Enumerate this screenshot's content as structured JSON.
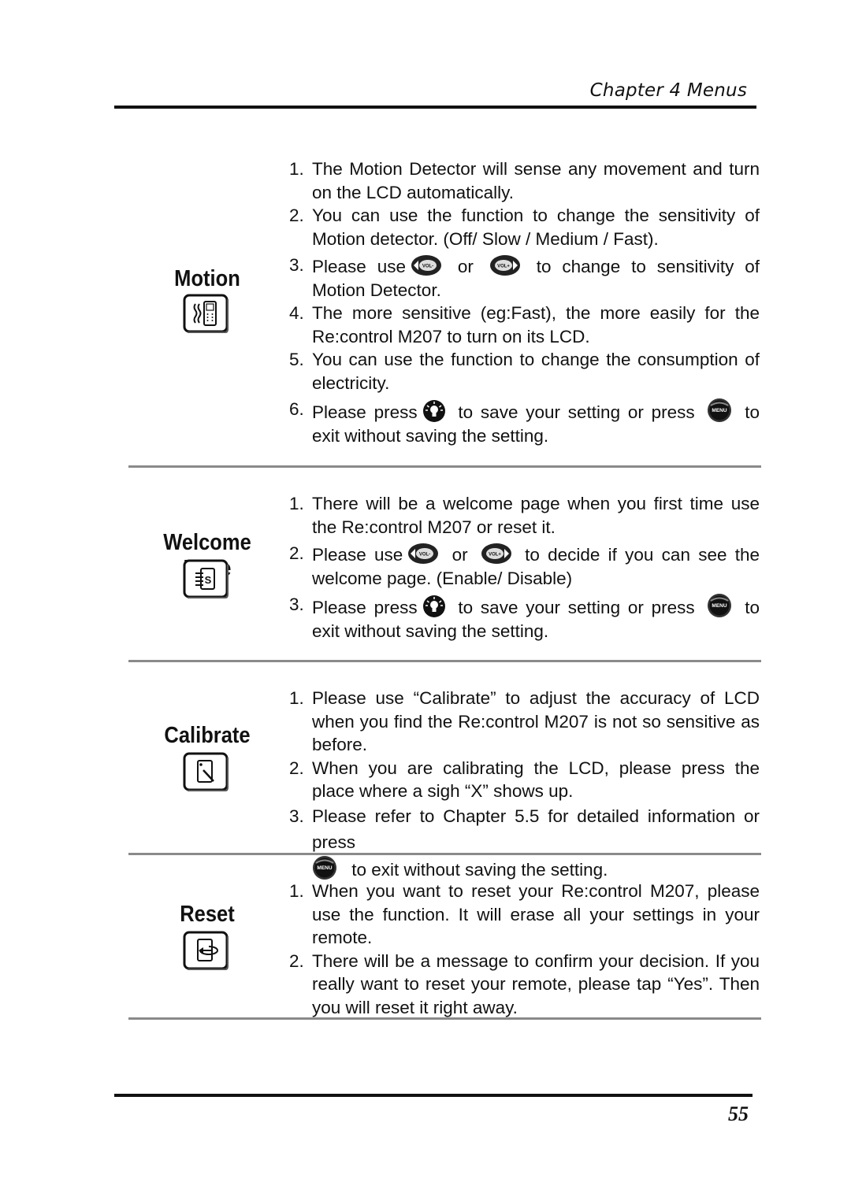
{
  "header": {
    "chapter_title": "Chapter 4 Menus"
  },
  "icons": {
    "vol_minus": "vol-minus-button-icon",
    "vol_plus": "vol-plus-button-icon",
    "save": "light-bulb-save-button-icon",
    "menu": "menu-button-icon"
  },
  "sections": [
    {
      "title": "Motion",
      "icon": "motion-detector-icon",
      "items": [
        {
          "num": "1.",
          "text": "The Motion Detector will sense any movement and turn on the LCD automatically."
        },
        {
          "num": "2.",
          "text": "You can use the function to change the sensitivity of Motion detector. (Off/ Slow / Medium / Fast)."
        },
        {
          "num": "3.",
          "pre": "Please use",
          "mid": "or",
          "post": "to change to sensitivity of Motion Detector."
        },
        {
          "num": "4.",
          "text": "The more sensitive (eg:Fast), the more easily for the Re:control M207 to turn on its LCD."
        },
        {
          "num": "5.",
          "text": "You can use the function to change the consumption of electricity."
        },
        {
          "num": "6.",
          "pre": "Please press",
          "mid": "to save your setting or press",
          "post": "to exit without saving the setting."
        }
      ]
    },
    {
      "title": "Welcome Page",
      "icon": "welcome-page-icon",
      "items": [
        {
          "num": "1.",
          "text": "There will be a welcome page when you first time use the Re:control M207 or reset it."
        },
        {
          "num": "2.",
          "pre": "Please use",
          "mid": "or",
          "post": "to decide if you can see the welcome page. (Enable/ Disable)"
        },
        {
          "num": "3.",
          "pre": "Please press",
          "mid": "to save your setting or press",
          "post": "to exit without saving the setting."
        }
      ]
    },
    {
      "title": "Calibrate",
      "icon": "calibrate-icon",
      "items": [
        {
          "num": "1.",
          "text": "Please use “Calibrate” to adjust the accuracy of LCD when you find the Re:control M207 is not so sensitive as before."
        },
        {
          "num": "2.",
          "text": "When you are calibrating the LCD, please press the place where a sigh “X” shows up."
        },
        {
          "num": "3.",
          "pre": "Please refer to Chapter 5.5 for detailed information or press",
          "post": "to exit without saving the setting."
        }
      ]
    },
    {
      "title": "Reset",
      "icon": "reset-icon",
      "items": [
        {
          "num": "1.",
          "text": "When you want to reset your Re:control M207, please use the function. It will erase all your settings in your remote."
        },
        {
          "num": "2.",
          "text": "There will be a message to confirm your decision. If you really want to reset your remote, please tap “Yes”. Then you will reset it right away."
        }
      ]
    }
  ],
  "footer": {
    "page_number": "55"
  }
}
